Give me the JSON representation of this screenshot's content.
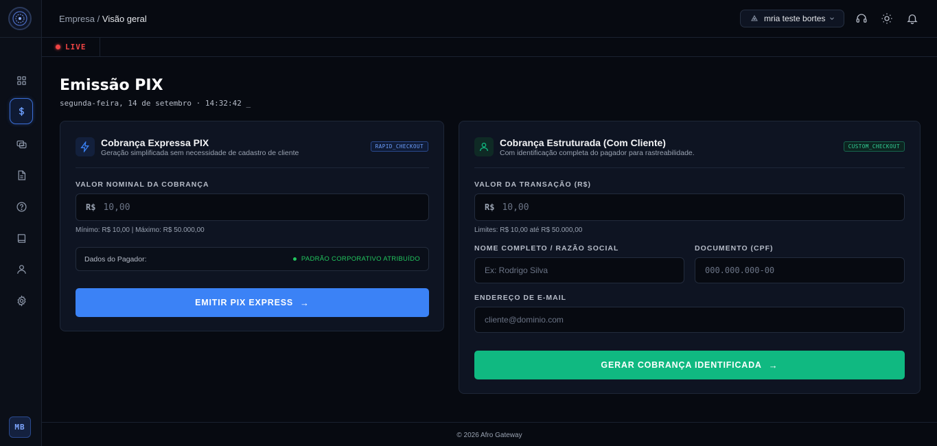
{
  "breadcrumb": {
    "parent": "Empresa",
    "separator": "/",
    "current": "Visão geral"
  },
  "user": {
    "name": "mria teste bortes"
  },
  "live": {
    "label": "LIVE"
  },
  "page": {
    "title": "Emissão PIX",
    "datetime": "segunda-feira, 14 de setembro · 14:32:42 _"
  },
  "express_card": {
    "title": "Cobrança Expressa PIX",
    "subtitle": "Geração simplificada sem necessidade de cadastro de cliente",
    "tag": "RAPID_CHECKOUT",
    "amount_label": "VALOR NOMINAL DA COBRANÇA",
    "currency_prefix": "R$",
    "amount_placeholder": "10,00",
    "amount_hint": "Mínimo: R$ 10,00 | Máximo: R$ 50.000,00",
    "payer_label": "Dados do Pagador:",
    "payer_status": "PADRÃO CORPORATIVO ATRIBUÍDO",
    "button_label": "EMITIR PIX EXPRESS",
    "button_arrow": "→"
  },
  "structured_card": {
    "title": "Cobrança Estruturada (Com Cliente)",
    "subtitle": "Com identificação completa do pagador para rastreabilidade.",
    "tag": "CUSTOM_CHECKOUT",
    "amount_label": "VALOR DA TRANSAÇÃO (R$)",
    "currency_prefix": "R$",
    "amount_placeholder": "10,00",
    "amount_hint": "Limites: R$ 10,00 até R$ 50.000,00",
    "name_label": "NOME COMPLETO / RAZÃO SOCIAL",
    "name_placeholder": "Ex: Rodrigo Silva",
    "doc_label": "DOCUMENTO (CPF)",
    "doc_placeholder": "000.000.000-00",
    "email_label": "ENDEREÇO DE E-MAIL",
    "email_placeholder": "cliente@dominio.com",
    "button_label": "GERAR COBRANÇA IDENTIFICADA",
    "button_arrow": "→"
  },
  "sidebar": {
    "avatar_initials": "MB"
  },
  "footer": {
    "text": "© 2026 Afro Gateway"
  },
  "colors": {
    "primary_blue": "#3b82f6",
    "primary_green": "#10b981",
    "live_red": "#ef4444",
    "background": "#070a11"
  }
}
